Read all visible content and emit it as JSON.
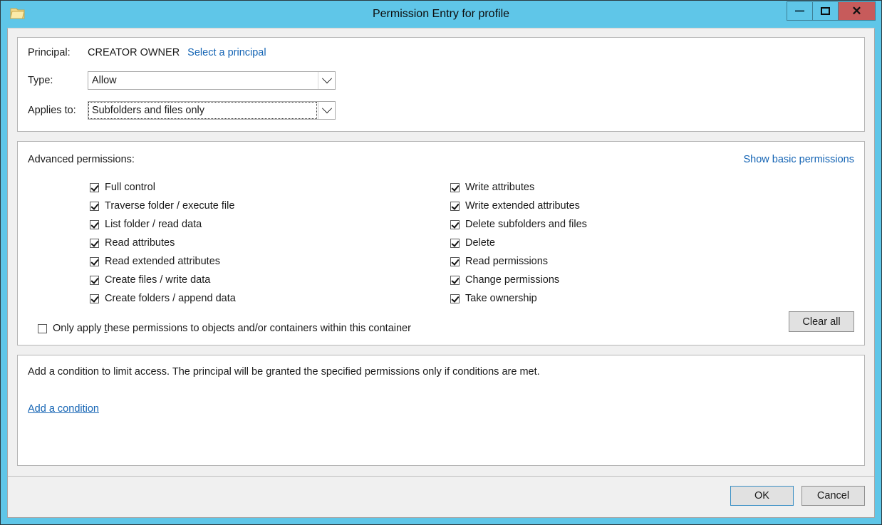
{
  "window": {
    "title": "Permission Entry for profile",
    "icon": "folder-icon",
    "accent_color": "#5fc6e8",
    "close_color": "#c75b5b",
    "buttons": {
      "minimize": "minimize-icon",
      "maximize": "maximize-icon",
      "close": "✕"
    }
  },
  "principal": {
    "label": "Principal:",
    "value": "CREATOR OWNER",
    "select_link": "Select a principal",
    "type_label": "Type:",
    "type_value": "Allow",
    "applies_label": "Applies to:",
    "applies_value": "Subfolders and files only"
  },
  "permissions": {
    "header": "Advanced permissions:",
    "show_basic_link": "Show basic permissions",
    "clear_all_label": "Clear all",
    "left_column": [
      {
        "label": "Full control",
        "checked": true
      },
      {
        "label": "Traverse folder / execute file",
        "checked": true
      },
      {
        "label": "List folder / read data",
        "checked": true
      },
      {
        "label": "Read attributes",
        "checked": true
      },
      {
        "label": "Read extended attributes",
        "checked": true
      },
      {
        "label": "Create files / write data",
        "checked": true
      },
      {
        "label": "Create folders / append data",
        "checked": true
      }
    ],
    "right_column": [
      {
        "label": "Write attributes",
        "checked": true
      },
      {
        "label": "Write extended attributes",
        "checked": true
      },
      {
        "label": "Delete subfolders and files",
        "checked": true
      },
      {
        "label": "Delete",
        "checked": true
      },
      {
        "label": "Read permissions",
        "checked": true
      },
      {
        "label": "Change permissions",
        "checked": true
      },
      {
        "label": "Take ownership",
        "checked": true
      }
    ],
    "only_apply": {
      "label_before": "Only apply ",
      "accel": "t",
      "label_after": "hese permissions to objects and/or containers within this container",
      "checked": false
    }
  },
  "conditions": {
    "description": "Add a condition to limit access. The principal will be granted the specified permissions only if conditions are met.",
    "add_link_before": "A",
    "add_link_accel": "d",
    "add_link_after": "d a condition"
  },
  "footer": {
    "ok_label": "OK",
    "cancel_label": "Cancel"
  }
}
